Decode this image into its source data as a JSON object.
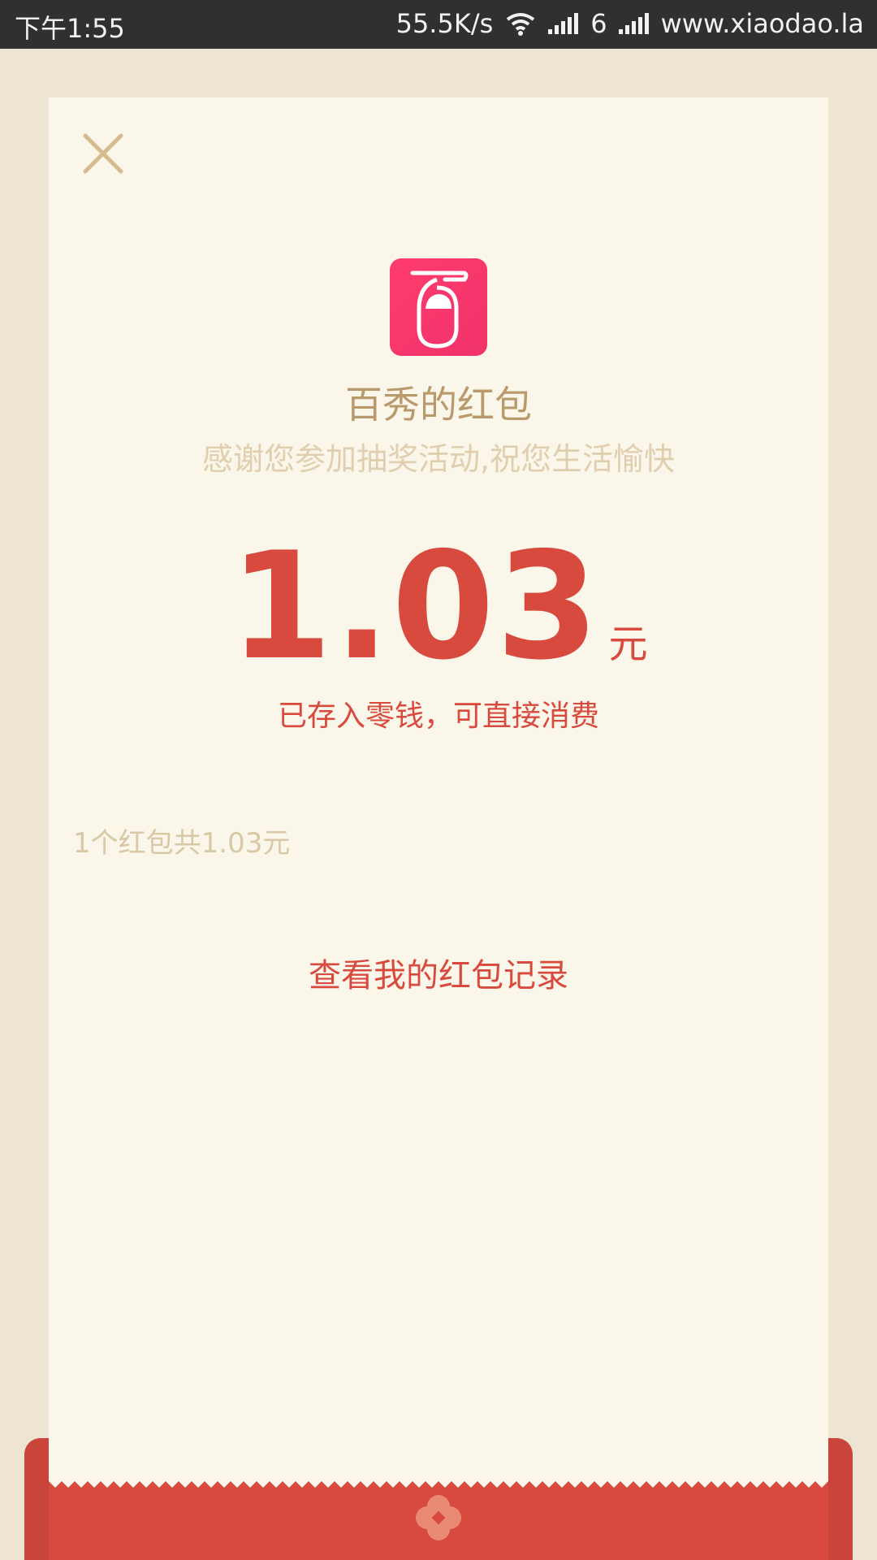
{
  "status_bar": {
    "time": "下午1:55",
    "speed": "55.5K/s",
    "sim_label": "6",
    "site": "www.xiaodao.la"
  },
  "packet": {
    "title": "百秀的红包",
    "subtitle": "感谢您参加抽奖活动,祝您生活愉快",
    "amount": "1.03",
    "unit": "元",
    "note": "已存入零钱，可直接消费",
    "summary": "1个红包共1.03元",
    "record_link": "查看我的红包记录"
  },
  "icons": [
    "close-icon",
    "app-logo",
    "wifi-icon",
    "signal-icon",
    "flower-icon"
  ],
  "colors": {
    "page_bg": "#ede4d2",
    "card_bg": "#fbf6ea",
    "accent_red": "#d94a3e",
    "title_gold": "#b89a6c",
    "logo_pink": "#ff3b6e"
  }
}
